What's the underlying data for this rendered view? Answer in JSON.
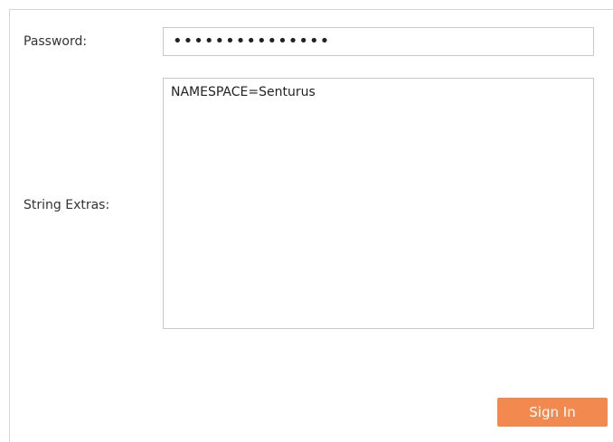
{
  "form": {
    "password": {
      "label": "Password:",
      "value": "•••••••••••••••"
    },
    "string_extras": {
      "label": "String Extras:",
      "value": "NAMESPACE=Senturus"
    },
    "submit": {
      "label": "Sign In"
    }
  },
  "colors": {
    "button_bg": "#f28a4f",
    "button_text": "#ffffff",
    "border": "#c8c8c8"
  }
}
